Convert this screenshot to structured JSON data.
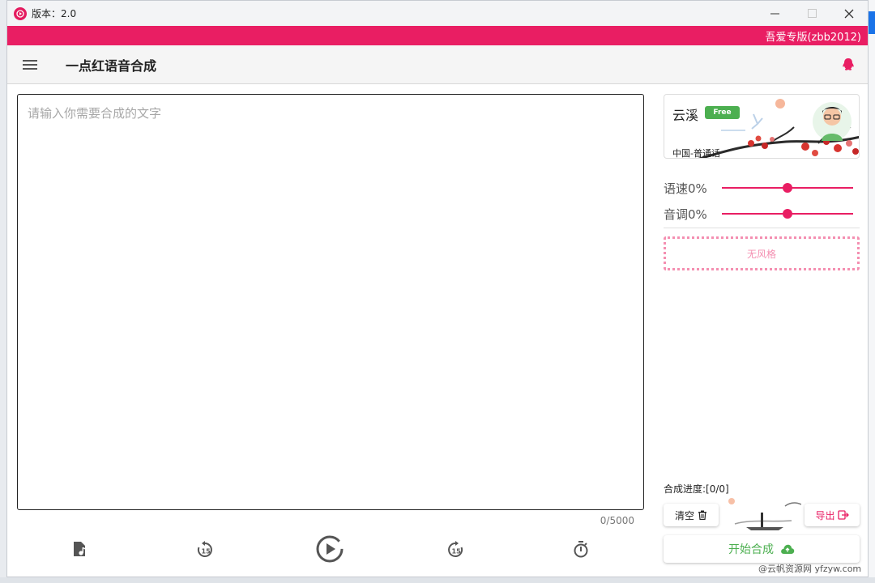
{
  "window": {
    "title": "版本：2.0",
    "controls": {
      "minimize": "—",
      "maximize": "☐",
      "close": "✕"
    }
  },
  "banner": {
    "text": "吾爱专版(zbb2012)"
  },
  "appbar": {
    "title": "一点红语音合成",
    "menu_icon": "hamburger-icon",
    "qq_icon": "qq-icon"
  },
  "editor": {
    "placeholder": "请输入你需要合成的文字",
    "counter": "0/5000"
  },
  "player": {
    "buttons": [
      "music-file-icon",
      "rewind-15-icon",
      "play-icon",
      "forward-15-icon",
      "timer-icon"
    ]
  },
  "voice": {
    "name": "云溪",
    "badge": "Free",
    "region": "中国-普通话"
  },
  "sliders": {
    "rate": {
      "label": "语速0%",
      "value": 0.5
    },
    "pitch": {
      "label": "音调0%",
      "value": 0.5
    }
  },
  "style": {
    "label": "无风格"
  },
  "progress": {
    "label": "合成进度:[0/0]"
  },
  "actions": {
    "clear": "清空",
    "export": "导出",
    "start": "开始合成"
  },
  "watermark": "@云帆资源网 yfzyw.com",
  "colors": {
    "accent": "#e91e63",
    "green": "#4caf50",
    "border": "#222222"
  }
}
